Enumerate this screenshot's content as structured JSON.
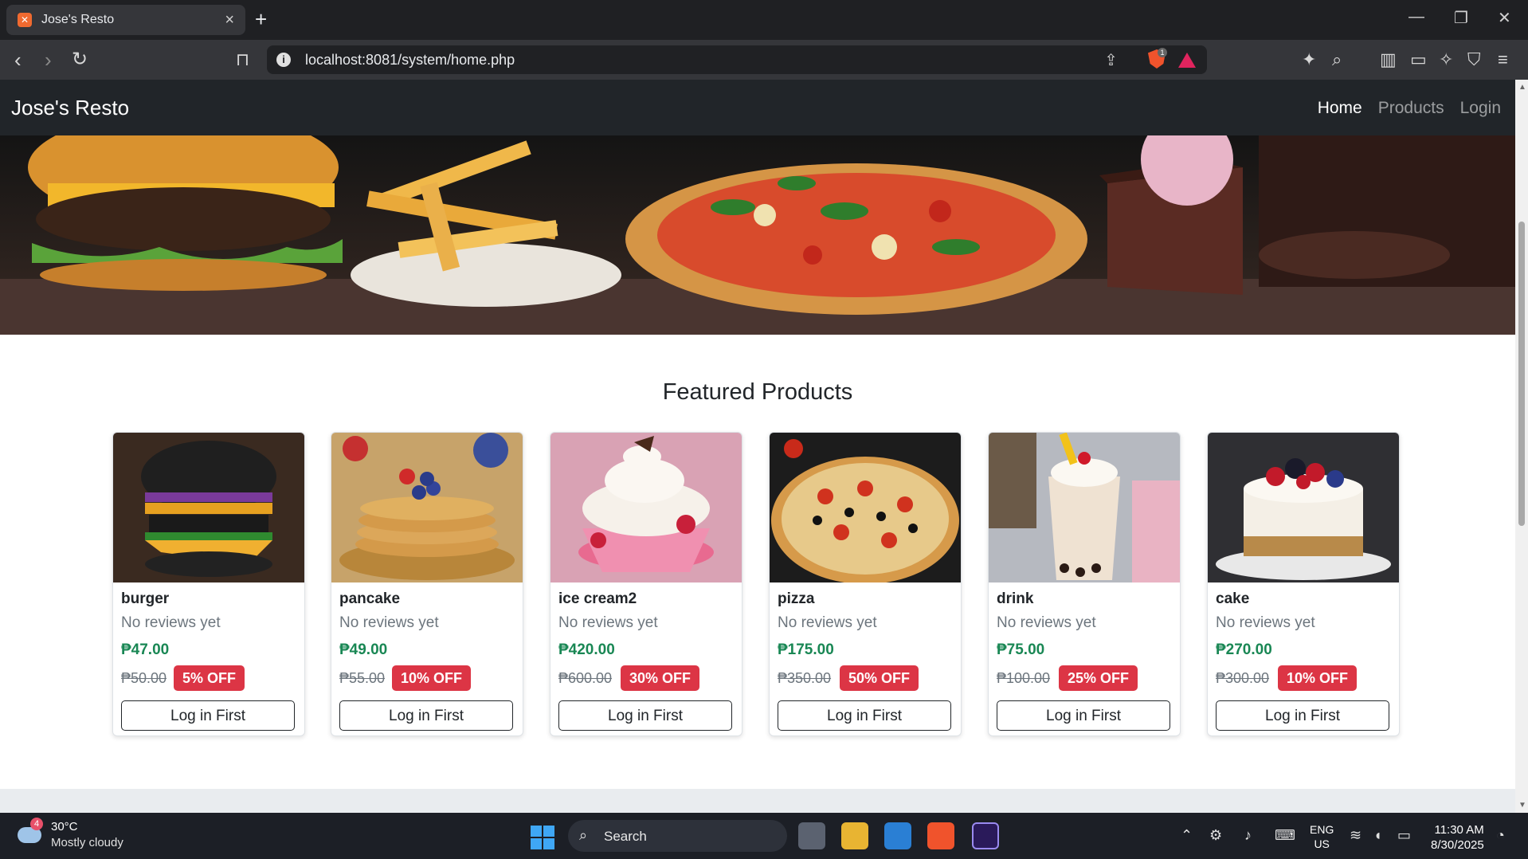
{
  "browser": {
    "tab_title": "Jose's Resto",
    "new_tab": "+",
    "url": "localhost:8081/system/home.php",
    "shields_count": "1"
  },
  "site": {
    "brand": "Jose's Resto",
    "nav": [
      "Home",
      "Products",
      "Login"
    ],
    "active_nav": "Home",
    "section_title": "Featured Products"
  },
  "products": [
    {
      "name": "burger",
      "reviews": "No reviews yet",
      "price": "₱47.00",
      "old_price": "₱50.00",
      "discount": "5% OFF",
      "button": "Log in First"
    },
    {
      "name": "pancake",
      "reviews": "No reviews yet",
      "price": "₱49.00",
      "old_price": "₱55.00",
      "discount": "10% OFF",
      "button": "Log in First"
    },
    {
      "name": "ice cream2",
      "reviews": "No reviews yet",
      "price": "₱420.00",
      "old_price": "₱600.00",
      "discount": "30% OFF",
      "button": "Log in First"
    },
    {
      "name": "pizza",
      "reviews": "No reviews yet",
      "price": "₱175.00",
      "old_price": "₱350.00",
      "discount": "50% OFF",
      "button": "Log in First"
    },
    {
      "name": "drink",
      "reviews": "No reviews yet",
      "price": "₱75.00",
      "old_price": "₱100.00",
      "discount": "25% OFF",
      "button": "Log in First"
    },
    {
      "name": "cake",
      "reviews": "No reviews yet",
      "price": "₱270.00",
      "old_price": "₱300.00",
      "discount": "10% OFF",
      "button": "Log in First"
    }
  ],
  "taskbar": {
    "weather_badge": "4",
    "temperature": "30°C",
    "condition": "Mostly cloudy",
    "search_label": "Search",
    "language": "ENG",
    "region": "US",
    "time": "11:30 AM",
    "date": "8/30/2025"
  },
  "colors": {
    "navbar": "#212529",
    "price_green": "#198754",
    "discount_red": "#dc3545",
    "taskbar": "#1c1f26"
  }
}
